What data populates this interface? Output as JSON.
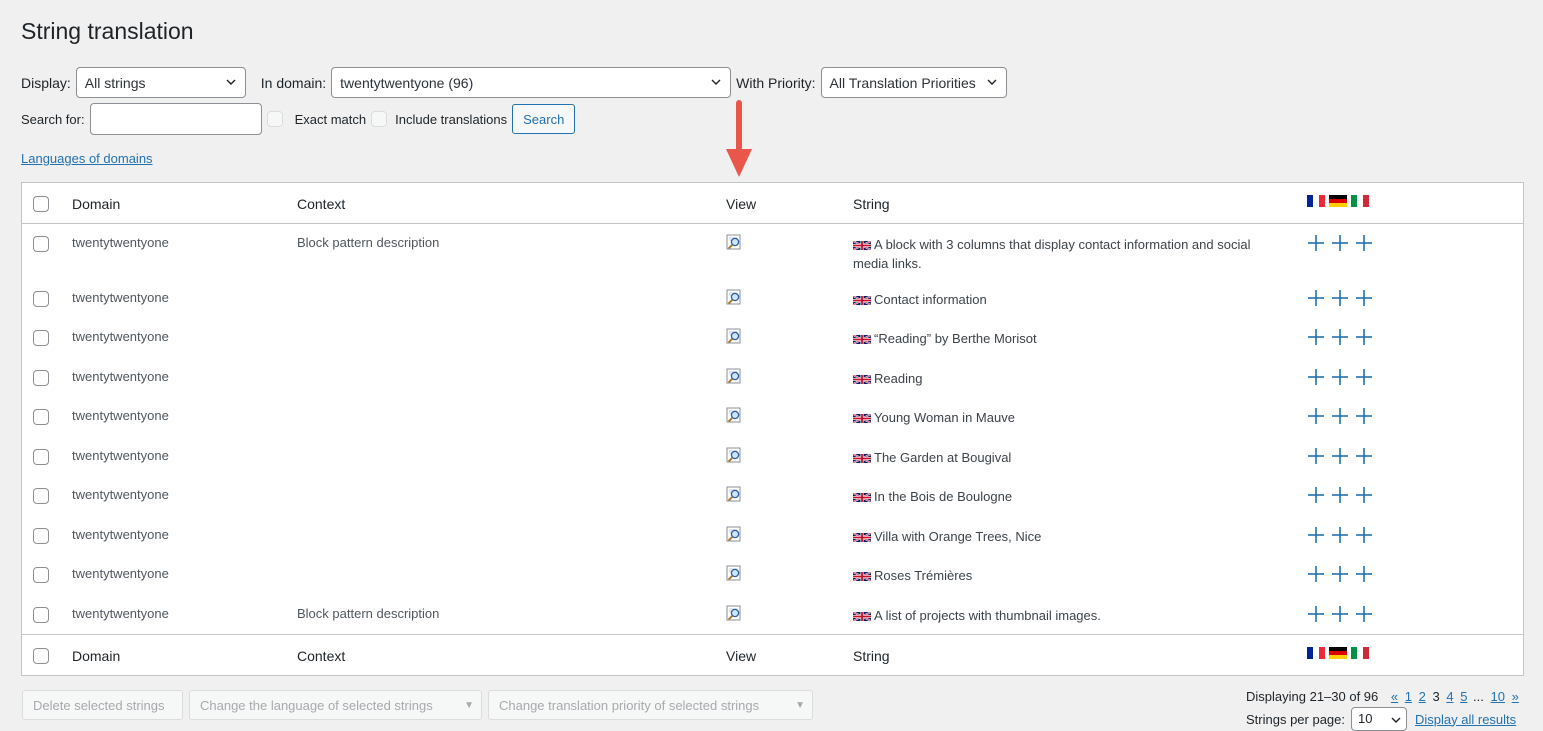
{
  "page": {
    "title": "String translation",
    "languages_link": "Languages of domains"
  },
  "filters": {
    "display_label": "Display:",
    "display_value": "All strings",
    "domain_label": "In domain:",
    "domain_value": "twentytwentyone (96)",
    "priority_label": "With Priority:",
    "priority_value": "All Translation Priorities",
    "search_label": "Search for:",
    "search_value": "",
    "exact_match_label": "Exact match",
    "include_translations_label": "Include translations",
    "search_button": "Search"
  },
  "table": {
    "columns": {
      "domain": "Domain",
      "context": "Context",
      "view": "View",
      "string": "String"
    },
    "language_flags": [
      "french-flag",
      "german-flag",
      "italian-flag"
    ],
    "rows": [
      {
        "domain": "twentytwentyone",
        "context": "Block pattern description",
        "string": "A block with 3 columns that display contact information and social media links."
      },
      {
        "domain": "twentytwentyone",
        "context": "",
        "string": "Contact information"
      },
      {
        "domain": "twentytwentyone",
        "context": "",
        "string": "“Reading” by Berthe Morisot"
      },
      {
        "domain": "twentytwentyone",
        "context": "",
        "string": "Reading"
      },
      {
        "domain": "twentytwentyone",
        "context": "",
        "string": "Young Woman in Mauve"
      },
      {
        "domain": "twentytwentyone",
        "context": "",
        "string": "The Garden at Bougival"
      },
      {
        "domain": "twentytwentyone",
        "context": "",
        "string": "In the Bois de Boulogne"
      },
      {
        "domain": "twentytwentyone",
        "context": "",
        "string": "Villa with Orange Trees, Nice"
      },
      {
        "domain": "twentytwentyone",
        "context": "",
        "string": "Roses Trémières"
      },
      {
        "domain": "twentytwentyone",
        "context": "Block pattern description",
        "string": "A list of projects with thumbnail images."
      }
    ]
  },
  "bulk_actions": {
    "delete": "Delete selected strings",
    "change_language": "Change the language of selected strings",
    "change_priority": "Change translation priority of selected strings"
  },
  "pagination": {
    "displaying": "Displaying 21–30 of 96",
    "first": "«",
    "page_1": "1",
    "page_2": "2",
    "current": "3",
    "page_4": "4",
    "page_5": "5",
    "ellipsis": "...",
    "last_page": "10",
    "next": "»",
    "per_page_label": "Strings per page:",
    "per_page_value": "10",
    "display_all": "Display all results"
  },
  "colors": {
    "accent": "#2271b1",
    "background": "#f0f0f1",
    "annotation_arrow": "#e8574a"
  }
}
